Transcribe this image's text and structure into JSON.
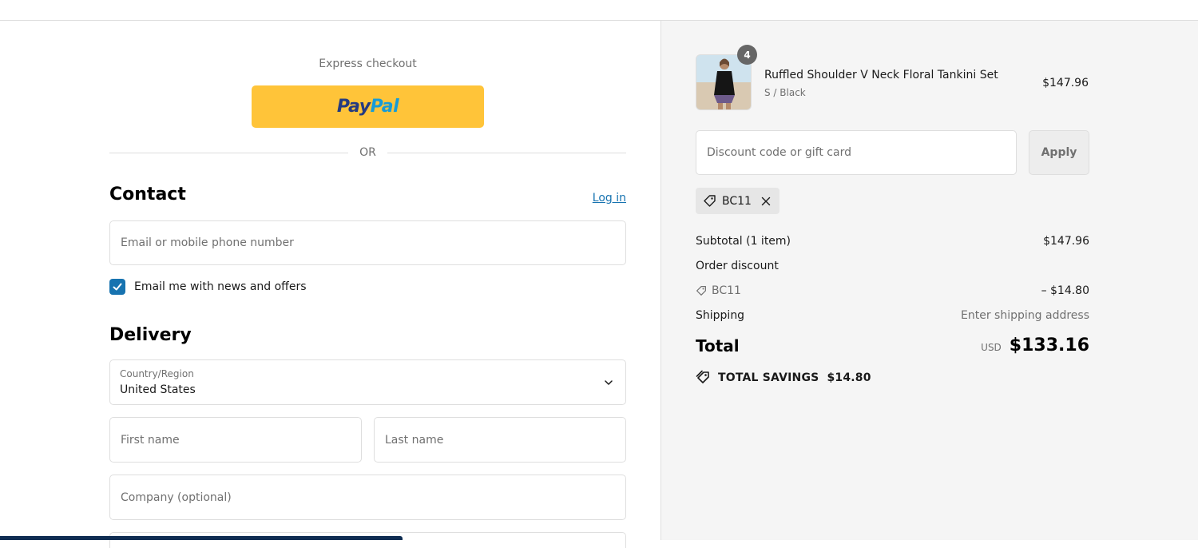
{
  "express": {
    "label": "Express checkout",
    "paypal_pay": "Pay",
    "paypal_pal": "Pal",
    "paypal_color": "#ffc439",
    "or_label": "OR"
  },
  "contact": {
    "title": "Contact",
    "login_label": "Log in",
    "email_placeholder": "Email or mobile phone number",
    "news_checkbox_label": "Email me with news and offers",
    "news_checked": true
  },
  "delivery": {
    "title": "Delivery",
    "country_label": "Country/Region",
    "country_value": "United States",
    "first_name_placeholder": "First name",
    "last_name_placeholder": "Last name",
    "company_placeholder": "Company (optional)"
  },
  "cart": {
    "item": {
      "quantity": "4",
      "title": "Ruffled Shoulder V Neck Floral Tankini Set",
      "variant": "S / Black",
      "price": "$147.96"
    },
    "discount_placeholder": "Discount code or gift card",
    "apply_label": "Apply",
    "applied_code": "BC11"
  },
  "summary": {
    "subtotal_label": "Subtotal (1 item)",
    "subtotal_value": "$147.96",
    "order_discount_label": "Order discount",
    "discount_code": "BC11",
    "discount_value": "– $14.80",
    "shipping_label": "Shipping",
    "shipping_value": "Enter shipping address",
    "total_label": "Total",
    "currency": "USD",
    "total_value": "$133.16",
    "savings_label": "TOTAL SAVINGS",
    "savings_value": "$14.80"
  },
  "icons": {
    "checkmark": "check-icon",
    "chevron": "chevron-down-icon",
    "tag": "tag-icon",
    "close": "close-icon",
    "savings_tag": "savings-tag-icon"
  },
  "colors": {
    "accent": "#1773b0",
    "paypal_yellow": "#ffc439",
    "sidebar_bg": "#f5f5f5"
  }
}
